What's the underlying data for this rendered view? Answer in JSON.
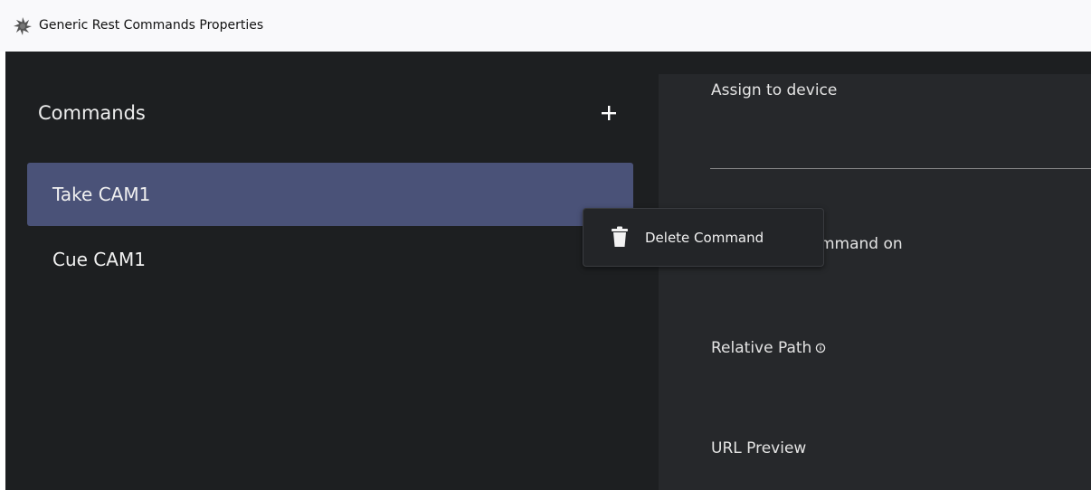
{
  "window": {
    "title": "Generic Rest Commands Properties",
    "icon": "app-logo-icon"
  },
  "sidebar": {
    "title": "Commands",
    "add_icon": "plus-icon",
    "items": [
      {
        "label": "Take CAM1",
        "selected": true
      },
      {
        "label": "Cue CAM1",
        "selected": false
      }
    ]
  },
  "content": {
    "assign_label": "Assign to device",
    "send_label_partial": "mmand on",
    "relative_path_label": "Relative Path",
    "relative_path_icon": "info-icon",
    "url_preview_label": "URL Preview"
  },
  "context_menu": {
    "items": [
      {
        "label": "Delete Command",
        "icon": "trash-icon"
      }
    ]
  },
  "colors": {
    "titlebar_bg": "#f9f9fb",
    "sidebar_bg": "#1d1f21",
    "content_bg": "#26282b",
    "selected_bg": "#4a5278"
  }
}
